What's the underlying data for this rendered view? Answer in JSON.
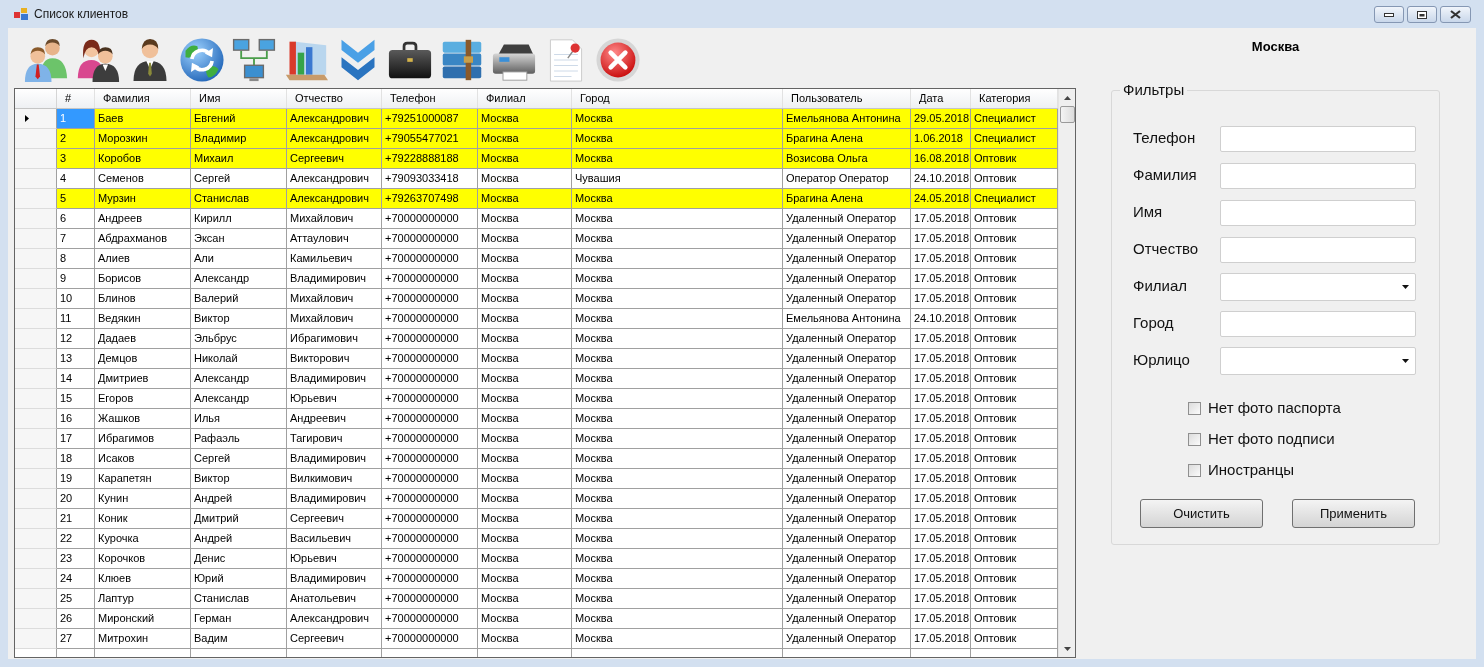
{
  "window": {
    "title": "Список клиентов"
  },
  "city_label": "Москва",
  "table": {
    "columns": [
      "#",
      "Фамилия",
      "Имя",
      "Отчество",
      "Телефон",
      "Филиал",
      "Город",
      "Пользователь",
      "Дата",
      "Категория"
    ],
    "rows": [
      {
        "cells": [
          "1",
          "Баев",
          "Евгений",
          "Александрович",
          "+79251000087",
          "Москва",
          "Москва",
          "Емельянова Антонина",
          "29.05.2018",
          "Специалист"
        ],
        "highlighted": true,
        "selected": true
      },
      {
        "cells": [
          "2",
          "Морозкин",
          "Владимир",
          "Александрович",
          "+79055477021",
          "Москва",
          "Москва",
          "Брагина Алена",
          "1.06.2018",
          "Специалист"
        ],
        "highlighted": true,
        "selected": false
      },
      {
        "cells": [
          "3",
          "Коробов",
          "Михаил",
          "Сергеевич",
          "+79228888188",
          "Москва",
          "Москва",
          "Возисова Ольга",
          "16.08.2018",
          "Оптовик"
        ],
        "highlighted": true,
        "selected": false
      },
      {
        "cells": [
          "4",
          "Семенов",
          "Сергей",
          "Александрович",
          "+79093033418",
          "Москва",
          "Чувашия",
          "Оператор Оператор",
          "24.10.2018",
          "Оптовик"
        ],
        "highlighted": false,
        "selected": false
      },
      {
        "cells": [
          "5",
          "Мурзин",
          "Станислав",
          "Александрович",
          "+79263707498",
          "Москва",
          "Москва",
          "Брагина Алена",
          "24.05.2018",
          "Специалист"
        ],
        "highlighted": true,
        "selected": false
      },
      {
        "cells": [
          "6",
          "Андреев",
          "Кирилл",
          "Михайлович",
          "+70000000000",
          "Москва",
          "Москва",
          "Удаленный Оператор",
          "17.05.2018",
          "Оптовик"
        ],
        "highlighted": false,
        "selected": false
      },
      {
        "cells": [
          "7",
          "Абдрахманов",
          "Эксан",
          "Аттаулович",
          "+70000000000",
          "Москва",
          "Москва",
          "Удаленный Оператор",
          "17.05.2018",
          "Оптовик"
        ],
        "highlighted": false,
        "selected": false
      },
      {
        "cells": [
          "8",
          "Алиев",
          "Али",
          "Камильевич",
          "+70000000000",
          "Москва",
          "Москва",
          "Удаленный Оператор",
          "17.05.2018",
          "Оптовик"
        ],
        "highlighted": false,
        "selected": false
      },
      {
        "cells": [
          "9",
          "Борисов",
          "Александр",
          "Владимирович",
          "+70000000000",
          "Москва",
          "Москва",
          "Удаленный Оператор",
          "17.05.2018",
          "Оптовик"
        ],
        "highlighted": false,
        "selected": false
      },
      {
        "cells": [
          "10",
          "Блинов",
          "Валерий",
          "Михайлович",
          "+70000000000",
          "Москва",
          "Москва",
          "Удаленный Оператор",
          "17.05.2018",
          "Оптовик"
        ],
        "highlighted": false,
        "selected": false
      },
      {
        "cells": [
          "11",
          "Ведякин",
          "Виктор",
          "Михайлович",
          "+70000000000",
          "Москва",
          "Москва",
          "Емельянова Антонина",
          "24.10.2018",
          "Оптовик"
        ],
        "highlighted": false,
        "selected": false
      },
      {
        "cells": [
          "12",
          "Дадаев",
          "Эльбрус",
          "Ибрагимович",
          "+70000000000",
          "Москва",
          "Москва",
          "Удаленный Оператор",
          "17.05.2018",
          "Оптовик"
        ],
        "highlighted": false,
        "selected": false
      },
      {
        "cells": [
          "13",
          "Демцов",
          "Николай",
          "Викторович",
          "+70000000000",
          "Москва",
          "Москва",
          "Удаленный Оператор",
          "17.05.2018",
          "Оптовик"
        ],
        "highlighted": false,
        "selected": false
      },
      {
        "cells": [
          "14",
          "Дмитриев",
          "Александр",
          "Владимирович",
          "+70000000000",
          "Москва",
          "Москва",
          "Удаленный Оператор",
          "17.05.2018",
          "Оптовик"
        ],
        "highlighted": false,
        "selected": false
      },
      {
        "cells": [
          "15",
          "Егоров",
          "Александр",
          "Юрьевич",
          "+70000000000",
          "Москва",
          "Москва",
          "Удаленный Оператор",
          "17.05.2018",
          "Оптовик"
        ],
        "highlighted": false,
        "selected": false
      },
      {
        "cells": [
          "16",
          "Жашков",
          "Илья",
          "Андреевич",
          "+70000000000",
          "Москва",
          "Москва",
          "Удаленный Оператор",
          "17.05.2018",
          "Оптовик"
        ],
        "highlighted": false,
        "selected": false
      },
      {
        "cells": [
          "17",
          "Ибрагимов",
          "Рафаэль",
          "Тагирович",
          "+70000000000",
          "Москва",
          "Москва",
          "Удаленный Оператор",
          "17.05.2018",
          "Оптовик"
        ],
        "highlighted": false,
        "selected": false
      },
      {
        "cells": [
          "18",
          "Исаков",
          "Сергей",
          "Владимирович",
          "+70000000000",
          "Москва",
          "Москва",
          "Удаленный Оператор",
          "17.05.2018",
          "Оптовик"
        ],
        "highlighted": false,
        "selected": false
      },
      {
        "cells": [
          "19",
          "Карапетян",
          "Виктор",
          "Вилкимович",
          "+70000000000",
          "Москва",
          "Москва",
          "Удаленный Оператор",
          "17.05.2018",
          "Оптовик"
        ],
        "highlighted": false,
        "selected": false
      },
      {
        "cells": [
          "20",
          "Кунин",
          "Андрей",
          "Владимирович",
          "+70000000000",
          "Москва",
          "Москва",
          "Удаленный Оператор",
          "17.05.2018",
          "Оптовик"
        ],
        "highlighted": false,
        "selected": false
      },
      {
        "cells": [
          "21",
          "Коник",
          "Дмитрий",
          "Сергеевич",
          "+70000000000",
          "Москва",
          "Москва",
          "Удаленный Оператор",
          "17.05.2018",
          "Оптовик"
        ],
        "highlighted": false,
        "selected": false
      },
      {
        "cells": [
          "22",
          "Курочка",
          "Андрей",
          "Васильевич",
          "+70000000000",
          "Москва",
          "Москва",
          "Удаленный Оператор",
          "17.05.2018",
          "Оптовик"
        ],
        "highlighted": false,
        "selected": false
      },
      {
        "cells": [
          "23",
          "Корочков",
          "Денис",
          "Юрьевич",
          "+70000000000",
          "Москва",
          "Москва",
          "Удаленный Оператор",
          "17.05.2018",
          "Оптовик"
        ],
        "highlighted": false,
        "selected": false
      },
      {
        "cells": [
          "24",
          "Клюев",
          "Юрий",
          "Владимирович",
          "+70000000000",
          "Москва",
          "Москва",
          "Удаленный Оператор",
          "17.05.2018",
          "Оптовик"
        ],
        "highlighted": false,
        "selected": false
      },
      {
        "cells": [
          "25",
          "Лаптур",
          "Станислав",
          "Анатольевич",
          "+70000000000",
          "Москва",
          "Москва",
          "Удаленный Оператор",
          "17.05.2018",
          "Оптовик"
        ],
        "highlighted": false,
        "selected": false
      },
      {
        "cells": [
          "26",
          "Миронский",
          "Герман",
          "Александрович",
          "+70000000000",
          "Москва",
          "Москва",
          "Удаленный Оператор",
          "17.05.2018",
          "Оптовик"
        ],
        "highlighted": false,
        "selected": false
      },
      {
        "cells": [
          "27",
          "Митрохин",
          "Вадим",
          "Сергеевич",
          "+70000000000",
          "Москва",
          "Москва",
          "Удаленный Оператор",
          "17.05.2018",
          "Оптовик"
        ],
        "highlighted": false,
        "selected": false
      }
    ]
  },
  "filters": {
    "title": "Фильтры",
    "fields": [
      {
        "label": "Телефон",
        "kind": "text"
      },
      {
        "label": "Фамилия",
        "kind": "text"
      },
      {
        "label": "Имя",
        "kind": "text"
      },
      {
        "label": "Отчество",
        "kind": "text"
      },
      {
        "label": "Филиал",
        "kind": "select"
      },
      {
        "label": "Город",
        "kind": "text"
      },
      {
        "label": "Юрлицо",
        "kind": "select"
      }
    ],
    "checkboxes": [
      {
        "label": "Нет фото паспорта",
        "checked": false
      },
      {
        "label": "Нет фото подписи",
        "checked": false
      },
      {
        "label": "Иностранцы",
        "checked": false
      }
    ],
    "buttons": [
      "Очистить",
      "Применить"
    ]
  }
}
